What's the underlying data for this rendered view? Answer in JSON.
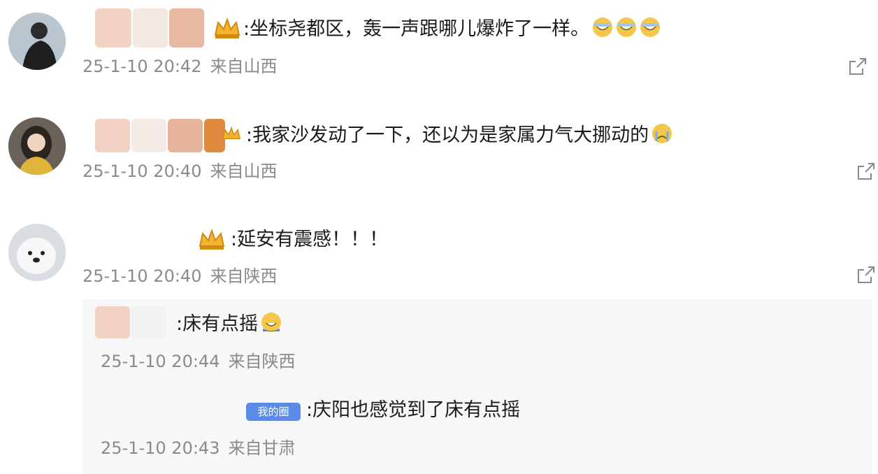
{
  "comments": [
    {
      "text": ":坐标尧都区，轰一声跟哪儿爆炸了一样。",
      "emoji_count": 3,
      "date": "25-1-10 20:42",
      "location": "来自山西"
    },
    {
      "text": ":我家沙发动了一下，还以为是家属力气大挪动的",
      "emoji_count": 1,
      "date": "25-1-10 20:40",
      "location": "来自山西"
    },
    {
      "text": ":延安有震感！！！",
      "date": "25-1-10 20:40",
      "location": "来自陕西"
    }
  ],
  "replies": [
    {
      "text": ":床有点摇",
      "date": "25-1-10 20:44",
      "location": "来自陕西"
    },
    {
      "badge": "我的圈",
      "text": ":庆阳也感觉到了床有点摇",
      "date": "25-1-10 20:43",
      "location": "来自甘肃"
    }
  ],
  "icons": {
    "share": "share-icon",
    "crown": "crown-badge-icon",
    "emoji_laugh": "laugh-cry-emoji-icon",
    "emoji_cry": "crying-emoji-icon",
    "emoji_sweat": "sweat-emoji-icon"
  },
  "colors": {
    "meta_text": "#8a8a8a",
    "badge_bg": "#5a8be6",
    "reply_bg": "#f7f7f7"
  }
}
